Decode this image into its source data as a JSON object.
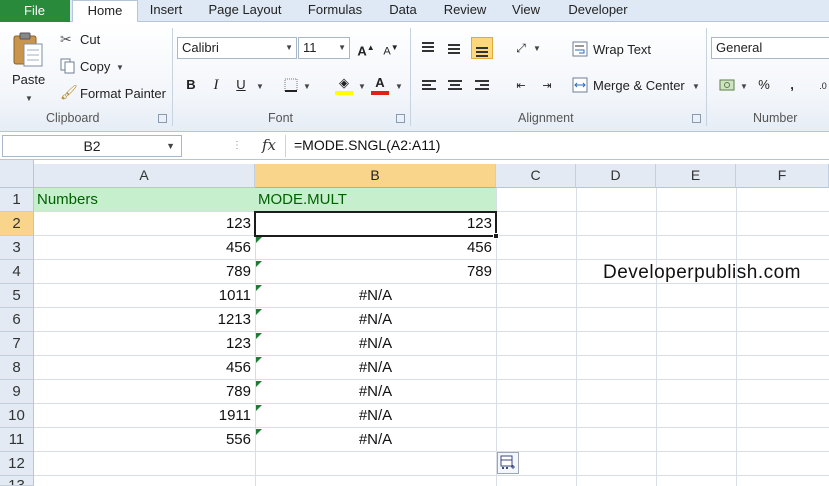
{
  "tabs": {
    "file": "File",
    "items": [
      "Home",
      "Insert",
      "Page Layout",
      "Formulas",
      "Data",
      "Review",
      "View",
      "Developer"
    ],
    "active": "Home"
  },
  "ribbon": {
    "clipboard": {
      "paste": "Paste",
      "cut": "Cut",
      "copy": "Copy",
      "format_painter": "Format Painter",
      "label": "Clipboard"
    },
    "font": {
      "name": "Calibri",
      "size": "11",
      "bold": "B",
      "italic": "I",
      "underline": "U",
      "grow": "A",
      "shrink": "A",
      "label": "Font"
    },
    "alignment": {
      "wrap_text": "Wrap Text",
      "merge_center": "Merge & Center",
      "label": "Alignment"
    },
    "number": {
      "format": "General",
      "percent": "%",
      "comma": ",",
      "label": "Number"
    },
    "colors": {
      "file_tab": "#2a8a3b",
      "highlight": "#ffff00",
      "font_color": "#e0201b",
      "pressed": "#fcd87a"
    }
  },
  "formula_bar": {
    "name_box": "B2",
    "fx": "fx",
    "formula": "=MODE.SNGL(A2:A11)"
  },
  "sheet": {
    "columns": [
      "A",
      "B",
      "C",
      "D",
      "E",
      "F"
    ],
    "selected_column": "B",
    "rows": [
      "1",
      "2",
      "3",
      "4",
      "5",
      "6",
      "7",
      "8",
      "9",
      "10",
      "11",
      "12",
      "13"
    ],
    "selected_row": "2",
    "header_row": {
      "a": "Numbers",
      "b": "MODE.MULT"
    },
    "col_a": [
      "123",
      "456",
      "789",
      "1011",
      "1213",
      "123",
      "456",
      "789",
      "1911",
      "556"
    ],
    "col_b": [
      "123",
      "456",
      "789",
      "#N/A",
      "#N/A",
      "#N/A",
      "#N/A",
      "#N/A",
      "#N/A",
      "#N/A"
    ],
    "watermark": "Developerpublish.com",
    "header_fill": "#c6efce",
    "header_text": "#006100"
  }
}
